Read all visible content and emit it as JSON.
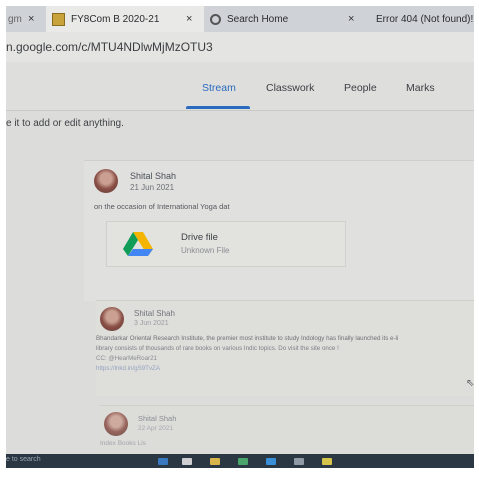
{
  "browser": {
    "tabs": [
      {
        "title": "gm",
        "close": "×"
      },
      {
        "title": "FY8Com B 2020-21",
        "close": "×"
      },
      {
        "title": "Search Home",
        "close": "×"
      },
      {
        "title": "Error 404 (Not found)!!1",
        "close": "×"
      }
    ],
    "url": "n.google.com/c/MTU4NDlwMjMzOTU3"
  },
  "classroom": {
    "nav": [
      "Stream",
      "Classwork",
      "People",
      "Marks"
    ],
    "hint": "e it to add or edit anything."
  },
  "posts": [
    {
      "author": "Shital Shah",
      "date": "21 Jun 2021",
      "text": "on the occasion of International Yoga dat",
      "attachment": {
        "title": "Drive file",
        "subtitle": "Unknown File"
      }
    },
    {
      "author": "Shital Shah",
      "date": "3 Jun 2021",
      "lines": [
        "Bhandarkar Oriental Research Institute, the premier most institute to study Indology has finally launched its e-li",
        "library consists of thousands of rare books on various Indic topics. Do visit the site once !",
        "CC: @HearMeRoar21",
        "https://lnkd.in/gS9TvZA"
      ]
    },
    {
      "author": "Shital Shah",
      "date": "22 Apr 2021",
      "text": "Index Books Lis"
    }
  ],
  "taskbar": {
    "search": "e to search"
  },
  "colors": {
    "accent": "#2a6bbf",
    "taskbar": "#2b3844"
  }
}
